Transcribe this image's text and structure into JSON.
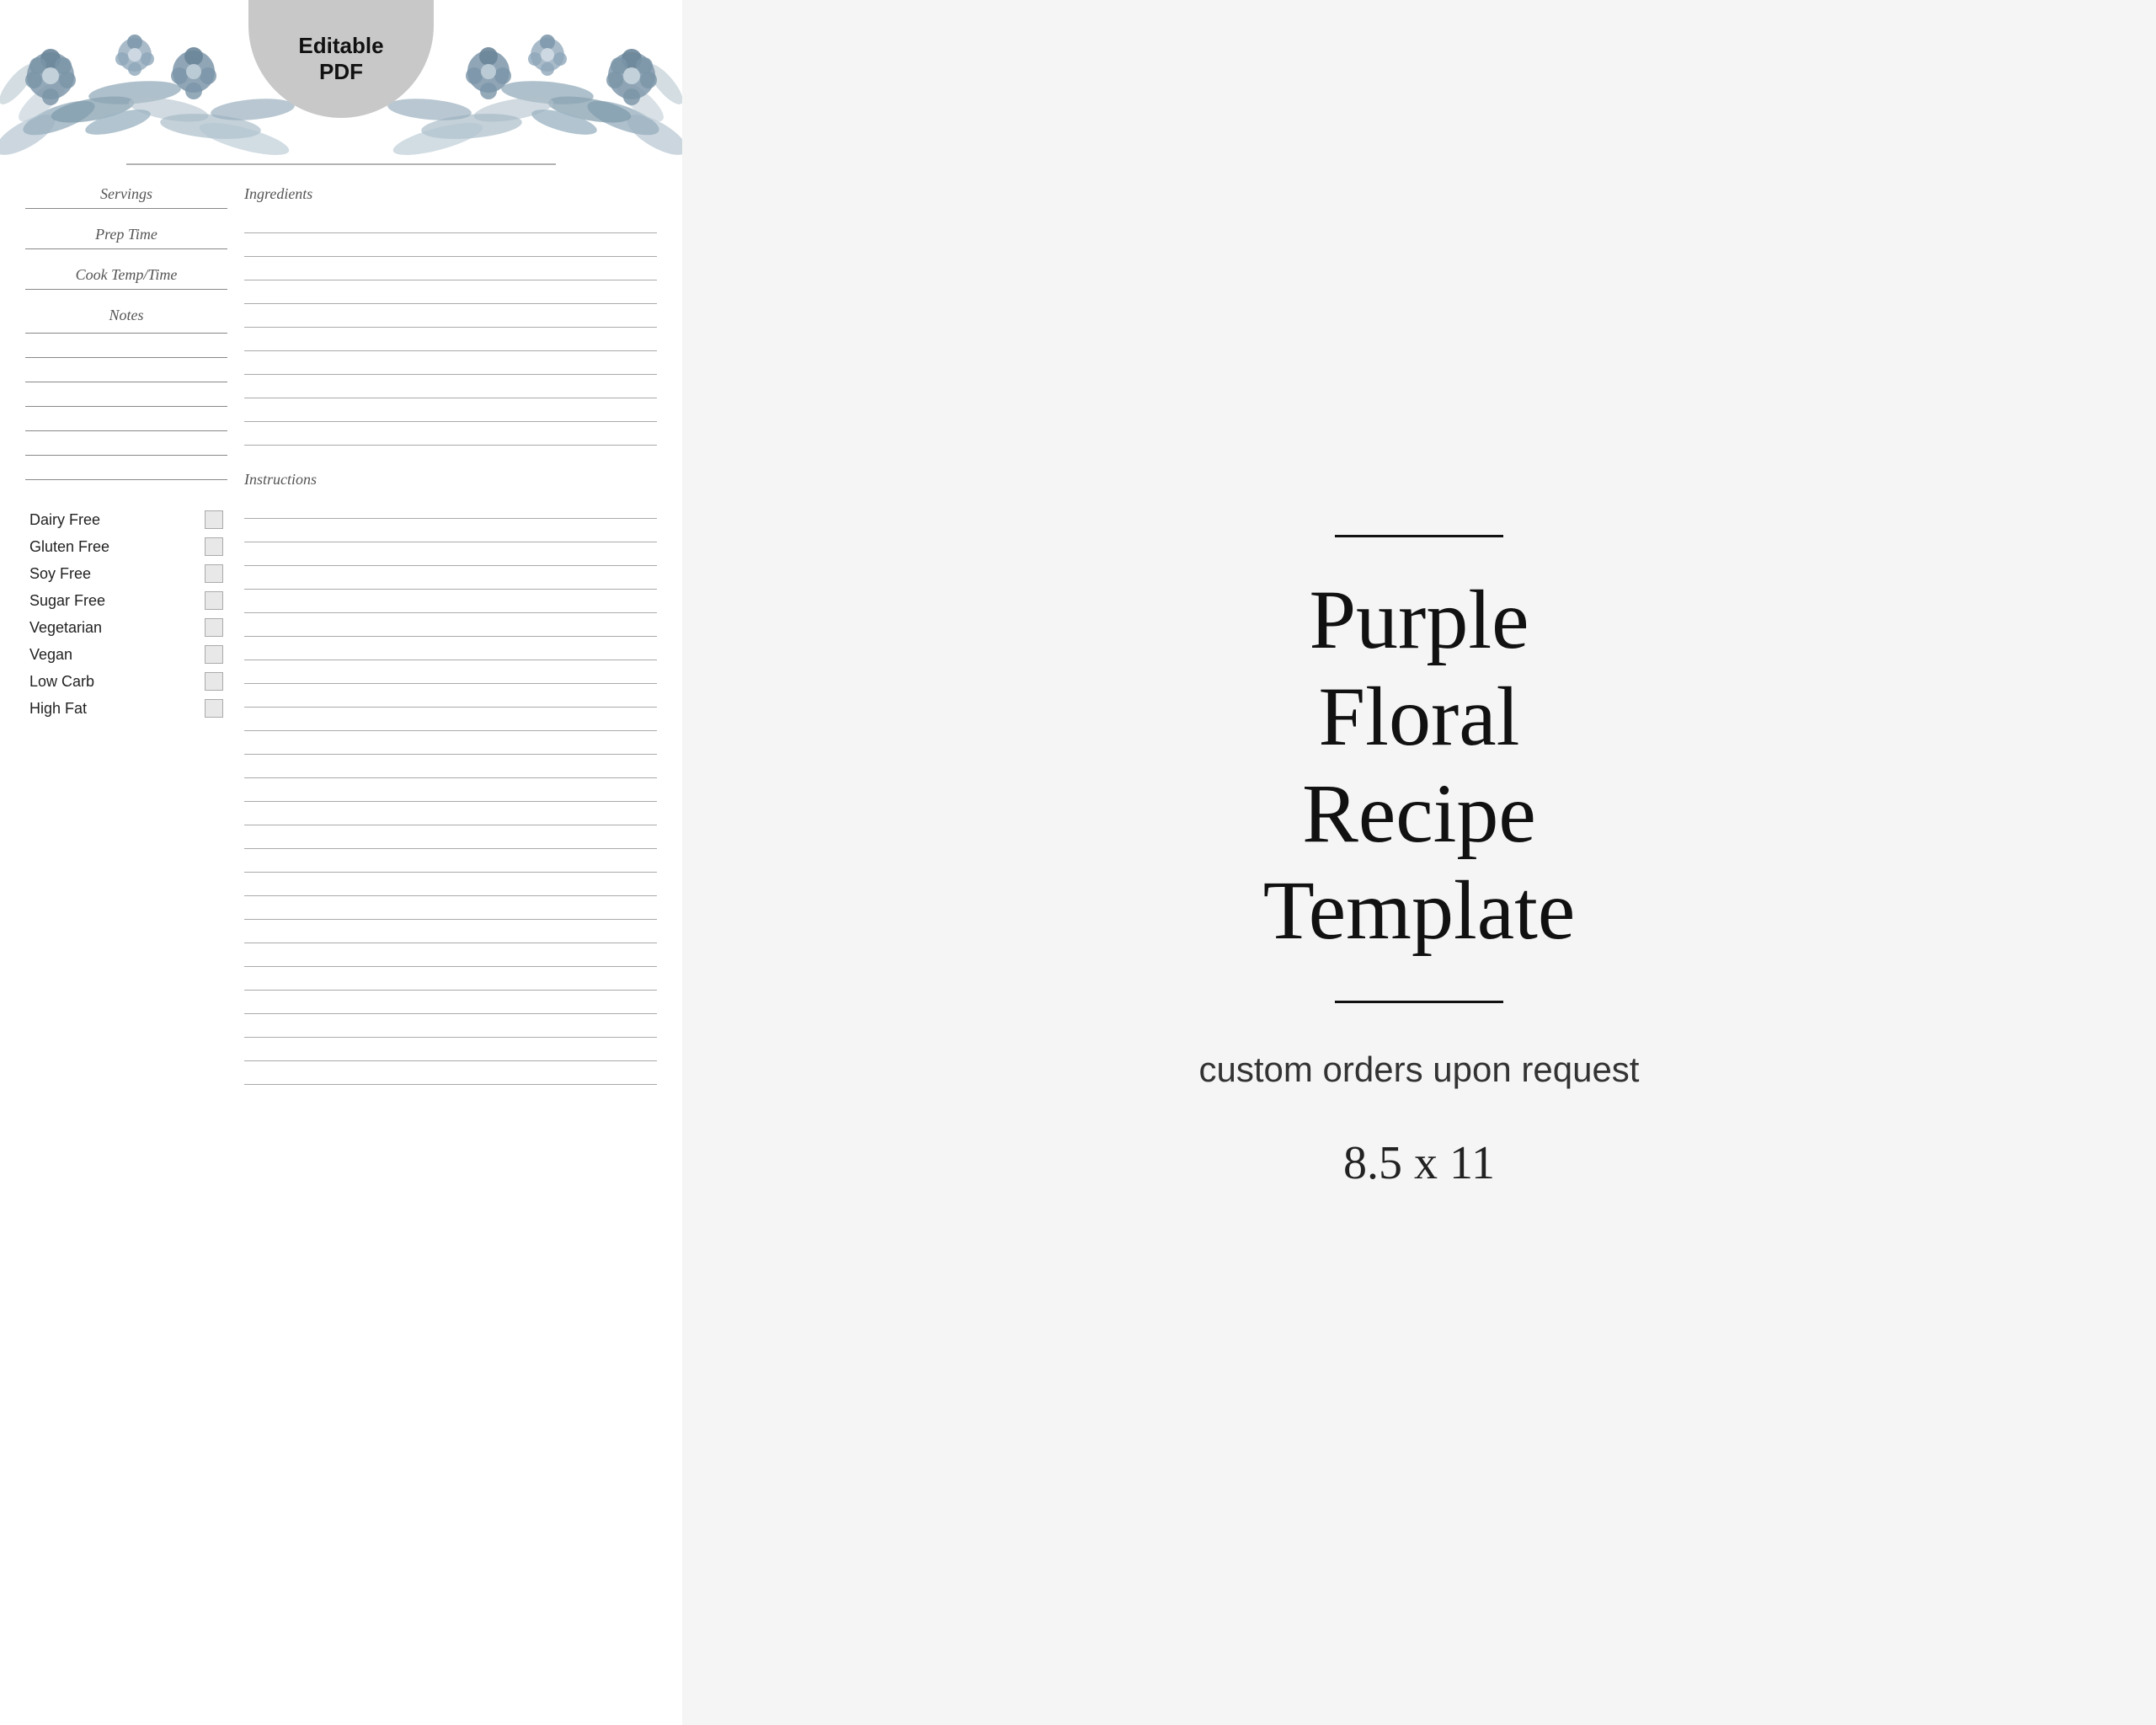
{
  "badge": {
    "line1": "Editable",
    "line2": "PDF"
  },
  "recipe_card": {
    "title_placeholder": "",
    "fields": {
      "servings": "Servings",
      "prep_time": "Prep Time",
      "cook_temp": "Cook Temp/Time",
      "notes": "Notes"
    },
    "ingredients_label": "Ingredients",
    "instructions_label": "Instructions",
    "dietary": [
      {
        "label": "Dairy Free"
      },
      {
        "label": "Gluten Free"
      },
      {
        "label": "Soy Free"
      },
      {
        "label": "Sugar Free"
      },
      {
        "label": "Vegetarian"
      },
      {
        "label": "Vegan"
      },
      {
        "label": "Low Carb"
      },
      {
        "label": "High Fat"
      }
    ]
  },
  "text_panel": {
    "title_line1": "Purple",
    "title_line2": "Floral",
    "title_line3": "Recipe",
    "title_line4": "Template",
    "subtitle": "custom orders upon request",
    "size": "8.5 x 11"
  }
}
